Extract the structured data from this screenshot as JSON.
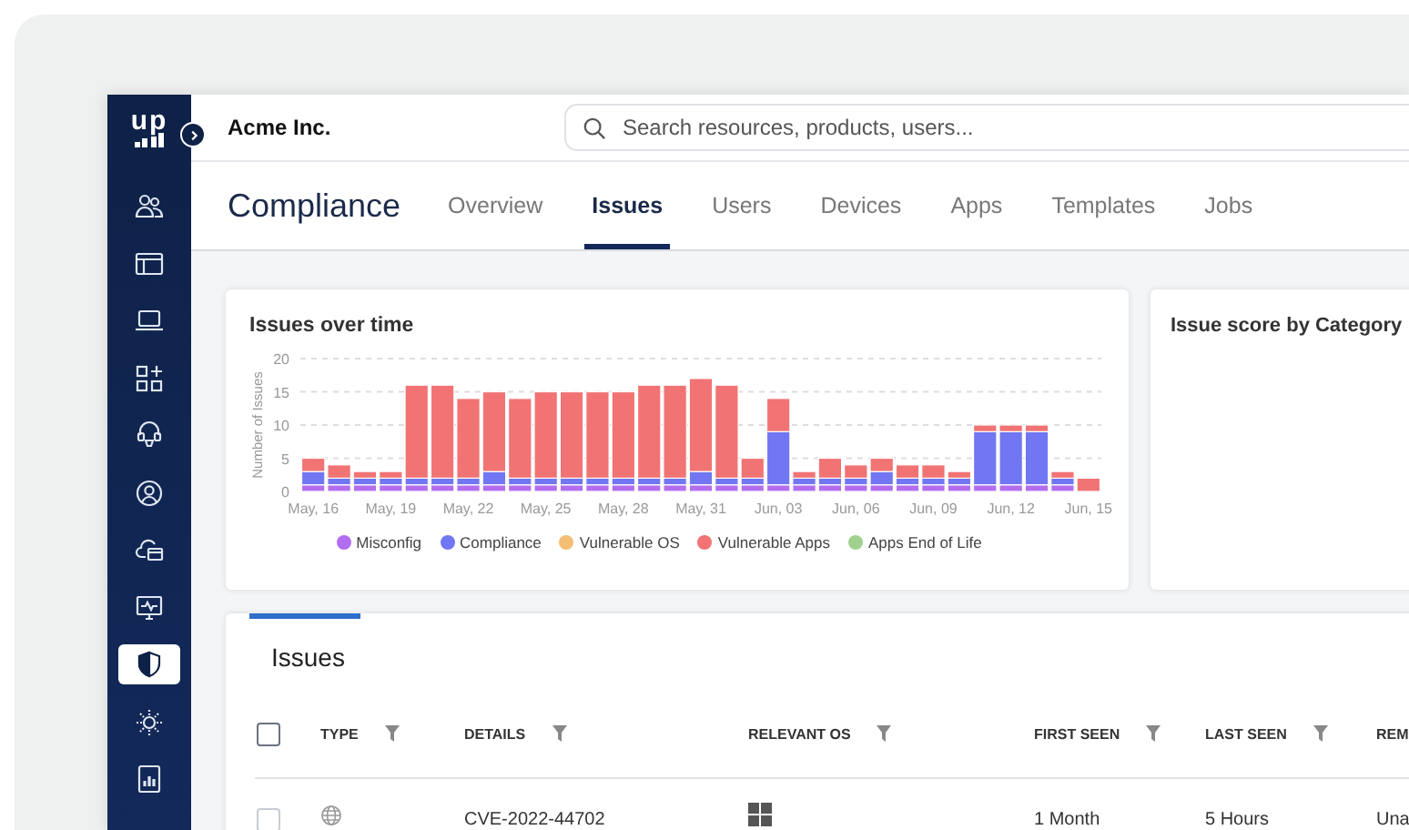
{
  "sidebar": {
    "logo": "up",
    "items": [
      {
        "selected": false
      },
      {
        "selected": false
      },
      {
        "selected": false
      },
      {
        "selected": false
      },
      {
        "selected": false
      },
      {
        "selected": false
      },
      {
        "selected": false
      },
      {
        "selected": false
      },
      {
        "selected": true
      },
      {
        "selected": false
      },
      {
        "selected": false
      }
    ]
  },
  "header": {
    "org": "Acme Inc.",
    "search": {
      "placeholder": "Search resources, products, users..."
    }
  },
  "page": {
    "title": "Compliance",
    "tabs": [
      {
        "label": "Overview",
        "selected": false
      },
      {
        "label": "Issues",
        "selected": true
      },
      {
        "label": "Users",
        "selected": false
      },
      {
        "label": "Devices",
        "selected": false
      },
      {
        "label": "Apps",
        "selected": false
      },
      {
        "label": "Templates",
        "selected": false
      },
      {
        "label": "Jobs",
        "selected": false
      }
    ]
  },
  "cards": [
    {
      "title": "Issues over time",
      "chart_data": {
        "type": "bar",
        "stacked": true,
        "ylabel": "Number of Issues",
        "ylim": [
          0,
          20
        ],
        "yticks": [
          0,
          5,
          10,
          15,
          20
        ],
        "grid": true,
        "legend": true,
        "categories": [
          "May, 16",
          null,
          null,
          "May, 19",
          null,
          null,
          "May, 22",
          null,
          null,
          "May, 25",
          null,
          null,
          "May, 28",
          null,
          null,
          "May, 31",
          null,
          null,
          "Jun, 03",
          null,
          null,
          "Jun, 06",
          null,
          null,
          "Jun, 09",
          null,
          null,
          "Jun, 12",
          null,
          null,
          "Jun, 15"
        ],
        "series": [
          {
            "name": "Misconfig",
            "color": "#b36ef0",
            "values": [
              1,
              1,
              1,
              1,
              1,
              1,
              1,
              1,
              1,
              1,
              1,
              1,
              1,
              1,
              1,
              1,
              1,
              1,
              1,
              1,
              1,
              1,
              1,
              1,
              1,
              1,
              1,
              1,
              1,
              1,
              0
            ]
          },
          {
            "name": "Compliance",
            "color": "#7176f2",
            "values": [
              2,
              1,
              1,
              1,
              1,
              1,
              1,
              2,
              1,
              1,
              1,
              1,
              1,
              1,
              1,
              2,
              1,
              1,
              8,
              1,
              1,
              1,
              2,
              1,
              1,
              1,
              8,
              8,
              8,
              1,
              0
            ]
          },
          {
            "name": "Vulnerable OS",
            "color": "#f4be74",
            "values": [
              0,
              0,
              0,
              0,
              0,
              0,
              0,
              0,
              0,
              0,
              0,
              0,
              0,
              0,
              0,
              0,
              0,
              0,
              0,
              0,
              0,
              0,
              0,
              0,
              0,
              0,
              0,
              0,
              0,
              0,
              0
            ]
          },
          {
            "name": "Vulnerable Apps",
            "color": "#f17374",
            "values": [
              2,
              2,
              1,
              1,
              14,
              14,
              12,
              12,
              12,
              13,
              13,
              13,
              13,
              14,
              14,
              14,
              14,
              3,
              5,
              1,
              3,
              2,
              2,
              2,
              2,
              1,
              1,
              1,
              1,
              1,
              2
            ]
          },
          {
            "name": "Apps End of Life",
            "color": "#a1d18f",
            "values": [
              0,
              0,
              0,
              0,
              0,
              0,
              0,
              0,
              0,
              0,
              0,
              0,
              0,
              0,
              0,
              0,
              0,
              0,
              0,
              0,
              0,
              0,
              0,
              0,
              0,
              0,
              0,
              0,
              0,
              0,
              0
            ]
          }
        ]
      }
    },
    {
      "title": "Issue score by Category"
    }
  ],
  "issues": {
    "title": "Issues",
    "select_all": {
      "checked": false
    },
    "columns": [
      {
        "label": "TYPE",
        "filter": true
      },
      {
        "label": "DETAILS",
        "filter": true
      },
      {
        "label": "RELEVANT OS",
        "filter": true
      },
      {
        "label": "FIRST SEEN",
        "filter": true
      },
      {
        "label": "LAST SEEN",
        "filter": true
      },
      {
        "label": "REM",
        "filter": false
      }
    ],
    "rows": [
      {
        "checked": false,
        "details": "CVE-2022-44702",
        "first_seen": "1 Month",
        "last_seen": "5 Hours",
        "column_7": "Una"
      }
    ]
  }
}
